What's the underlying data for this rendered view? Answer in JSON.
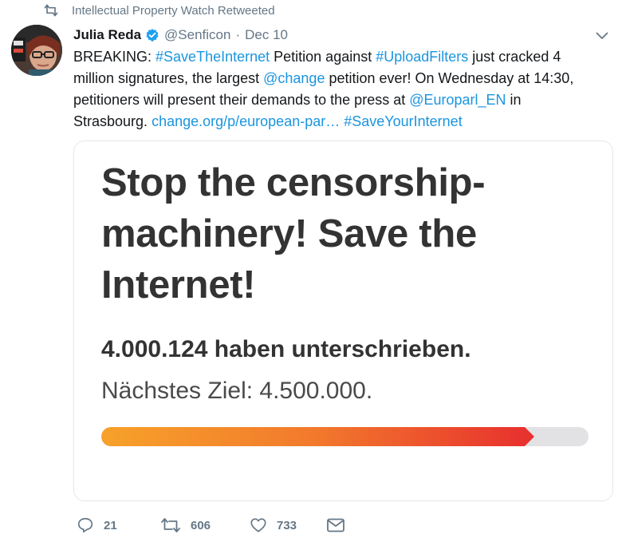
{
  "retweet_context": {
    "icon": "retweet-icon",
    "text": "Intellectual Property Watch Retweeted"
  },
  "author": {
    "name": "Julia Reda",
    "verified_icon": "verified-badge-icon",
    "handle": "@Senficon",
    "separator": "·",
    "date": "Dec 10"
  },
  "tweet": {
    "segments": [
      {
        "text": "BREAKING: ",
        "link": false
      },
      {
        "text": "#SaveTheInternet",
        "link": true
      },
      {
        "text": "  Petition against ",
        "link": false
      },
      {
        "text": "#UploadFilters",
        "link": true
      },
      {
        "text": " just cracked 4 million signatures, the largest ",
        "link": false
      },
      {
        "text": "@change",
        "link": true
      },
      {
        "text": " petition ever! On Wednesday at 14:30, petitioners will present their demands to the press at ",
        "link": false
      },
      {
        "text": "@Europarl_EN",
        "link": true
      },
      {
        "text": " in Strasbourg. ",
        "link": false
      },
      {
        "text": "change.org/p/european-par…",
        "link": true
      },
      {
        "text": " ",
        "link": false
      },
      {
        "text": "#SaveYourInternet",
        "link": true
      }
    ]
  },
  "card": {
    "title": "Stop the censorship-machinery! Save the Internet!",
    "signed": "4.000.124 haben unterschrieben.",
    "next_goal": "Nächstes Ziel: 4.500.000.",
    "progress_fraction": 0.889
  },
  "actions": {
    "reply": {
      "icon": "reply-icon",
      "count": "21"
    },
    "retweet": {
      "icon": "retweet-icon",
      "count": "606"
    },
    "like": {
      "icon": "heart-icon",
      "count": "733"
    },
    "dm": {
      "icon": "envelope-icon"
    }
  },
  "colors": {
    "link": "#1b95e0",
    "muted": "#657786",
    "verified": "#1da1f2",
    "progress_start": "#f7a12a",
    "progress_end": "#e8322e",
    "progress_track": "#e2e2e4"
  }
}
